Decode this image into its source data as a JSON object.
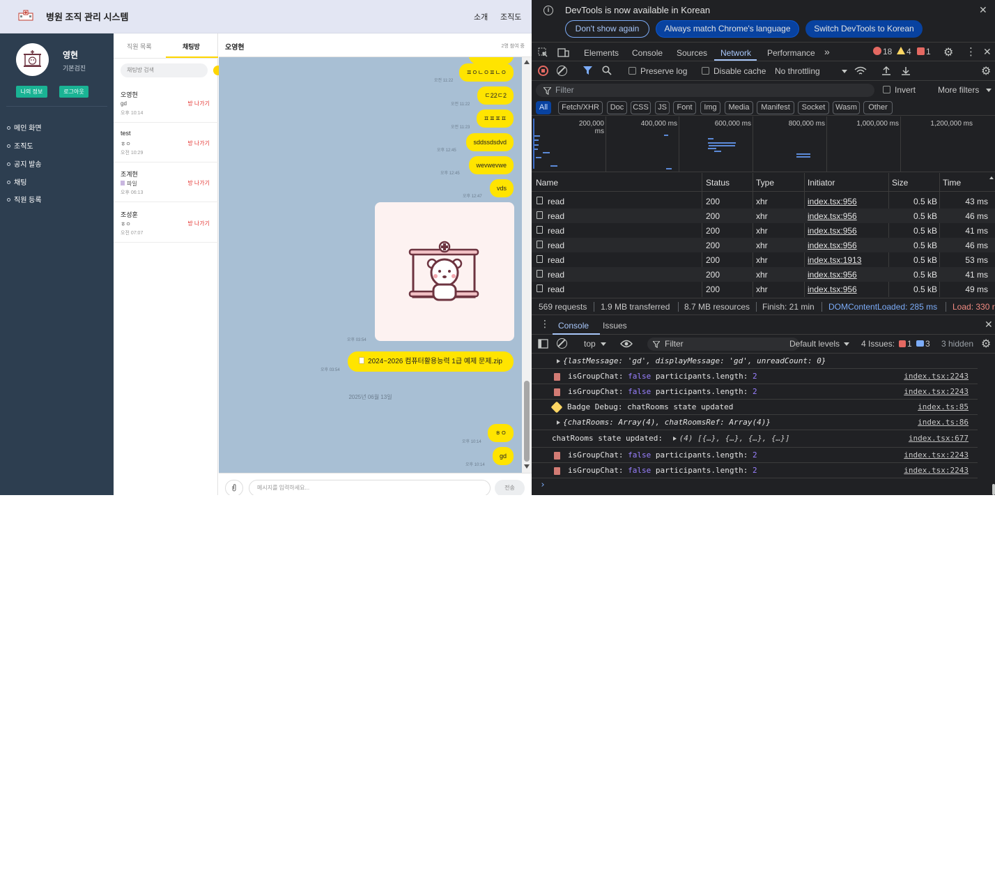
{
  "app": {
    "title": "병원 조직 관리 시스템",
    "nav_links": [
      "소개",
      "조직도"
    ],
    "user": {
      "name": "영현",
      "dept": "기본검진"
    },
    "side_buttons": [
      "나의 정보",
      "로그아웃"
    ],
    "menu": [
      "메인 화면",
      "조직도",
      "공지 발송",
      "채팅",
      "직원 등록"
    ],
    "list_tabs": [
      "직원 목록",
      "채팅방"
    ],
    "search_placeholder": "채팅방 검색",
    "rooms": [
      {
        "name": "오영현",
        "last": "gd",
        "time": "오후 10:14",
        "leave": "방 나가기"
      },
      {
        "name": "test",
        "last": "ㅎㅇ",
        "time": "오전 10:29",
        "leave": "방 나가기"
      },
      {
        "name": "조계현",
        "last": "파일",
        "time": "오후 06:13",
        "leave": "방 나가기"
      },
      {
        "name": "조성훈",
        "last": "ㅎㅇ",
        "time": "오전 07:07",
        "leave": "방 나가기"
      }
    ],
    "chat": {
      "title": "오영현",
      "participants": "2명 참여 중",
      "messages": [
        {
          "text": "ㅍㅇㄴㅇㅍㄴㅇ",
          "time": "오전 11:22"
        },
        {
          "text": "ㄷ22ㄷ2",
          "time": "오전 11:22"
        },
        {
          "text": "ㅍㅍㅍㅍ",
          "time": "오전 11:23"
        },
        {
          "text": "sddssdsdvd",
          "time": "오후 12:45"
        },
        {
          "text": "wevwevwe",
          "time": "오후 12:45"
        },
        {
          "text": "vds",
          "time": "오후 12:47"
        }
      ],
      "image_time": "오후 03:54",
      "file": {
        "name": "2024~2026 컴퓨터활용능력 1급 예제 문제.zip",
        "time": "오후 03:54"
      },
      "date_separator": "2025년 06월 13일",
      "late_messages": [
        {
          "text": "ㅎㅇ",
          "time": "오후 10:14"
        },
        {
          "text": "gd",
          "time": "오후 10:14"
        }
      ],
      "input_placeholder": "메시지를 입력하세요...",
      "send_label": "전송"
    }
  },
  "devtools": {
    "info": {
      "text": "DevTools is now available in Korean",
      "buttons": [
        "Don't show again",
        "Always match Chrome's language",
        "Switch DevTools to Korean"
      ]
    },
    "tabs": [
      "Elements",
      "Console",
      "Sources",
      "Network",
      "Performance"
    ],
    "counts": {
      "errors": "18",
      "warnings": "4",
      "info": "1"
    },
    "toolbar": {
      "preserve_log": "Preserve log",
      "disable_cache": "Disable cache",
      "throttling": "No throttling"
    },
    "filter": {
      "placeholder": "Filter",
      "invert": "Invert",
      "more": "More filters"
    },
    "types": [
      "All",
      "Fetch/XHR",
      "Doc",
      "CSS",
      "JS",
      "Font",
      "Img",
      "Media",
      "Manifest",
      "Socket",
      "Wasm",
      "Other"
    ],
    "timeline_labels": [
      "200,000 ms",
      "400,000 ms",
      "600,000 ms",
      "800,000 ms",
      "1,000,000 ms",
      "1,200,000 ms"
    ],
    "columns": [
      "Name",
      "Status",
      "Type",
      "Initiator",
      "Size",
      "Time"
    ],
    "rows": [
      {
        "name": "read",
        "status": "200",
        "type": "xhr",
        "initiator": "index.tsx:956",
        "size": "0.5 kB",
        "time": "43 ms"
      },
      {
        "name": "read",
        "status": "200",
        "type": "xhr",
        "initiator": "index.tsx:956",
        "size": "0.5 kB",
        "time": "46 ms"
      },
      {
        "name": "read",
        "status": "200",
        "type": "xhr",
        "initiator": "index.tsx:956",
        "size": "0.5 kB",
        "time": "41 ms"
      },
      {
        "name": "read",
        "status": "200",
        "type": "xhr",
        "initiator": "index.tsx:956",
        "size": "0.5 kB",
        "time": "46 ms"
      },
      {
        "name": "read",
        "status": "200",
        "type": "xhr",
        "initiator": "index.tsx:1913",
        "size": "0.5 kB",
        "time": "53 ms"
      },
      {
        "name": "read",
        "status": "200",
        "type": "xhr",
        "initiator": "index.tsx:956",
        "size": "0.5 kB",
        "time": "41 ms"
      },
      {
        "name": "read",
        "status": "200",
        "type": "xhr",
        "initiator": "index.tsx:956",
        "size": "0.5 kB",
        "time": "49 ms"
      }
    ],
    "summary": {
      "requests": "569 requests",
      "transferred": "1.9 MB transferred",
      "resources": "8.7 MB resources",
      "finish": "Finish: 21 min",
      "dcl": "DOMContentLoaded: 285 ms",
      "load": "Load: 330 r"
    },
    "console_tabs": [
      "Console",
      "Issues"
    ],
    "console_toolbar": {
      "context": "top",
      "filter": "Filter",
      "levels": "Default levels",
      "issues_label": "4 Issues:",
      "issues_err": "1",
      "issues_info": "3",
      "hidden": "3 hidden"
    },
    "logs": {
      "l0": "{lastMessage: 'gd', displayMessage: 'gd', unreadCount: 0}",
      "is_group": "isGroupChat:",
      "false_kw": "false",
      "participants": "participants.length:",
      "two": "2",
      "src_2243": "index.tsx:2243",
      "badge": "Badge Debug: chatRooms state updated",
      "src_85": "index.ts:85",
      "obj": "{chatRooms: Array(4), chatRoomsRef: Array(4)}",
      "src_86": "index.ts:86",
      "state": "chatRooms state updated:",
      "state_val": "(4) [{…}, {…}, {…}, {…}]",
      "src_677": "index.tsx:677"
    }
  }
}
